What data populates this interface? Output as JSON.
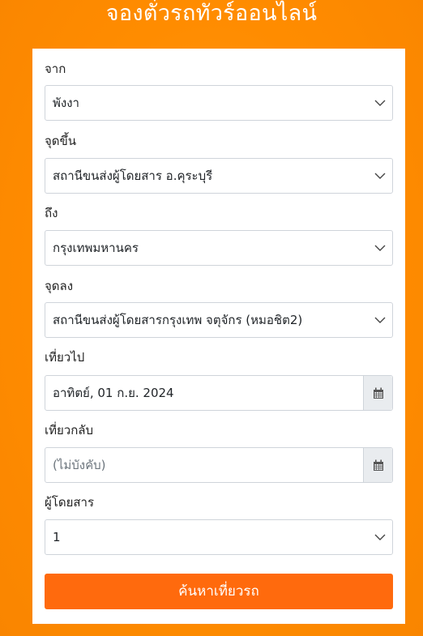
{
  "header": {
    "title": "จองตั๋วรถทัวร์ออนไลน์"
  },
  "form": {
    "from_label": "จาก",
    "from_value": "พังงา",
    "pickup_label": "จุดขึ้น",
    "pickup_value": "สถานีขนส่งผู้โดยสาร อ.คุระบุรี",
    "to_label": "ถึง",
    "to_value": "กรุงเทพมหานคร",
    "dropoff_label": "จุดลง",
    "dropoff_value": "สถานีขนส่งผู้โดยสารกรุงเทพ จตุจักร (หมอชิต2)",
    "depart_label": "เที่ยวไป",
    "depart_value": "อาทิตย์, 01 ก.ย. 2024",
    "return_label": "เที่ยวกลับ",
    "return_placeholder": "(ไม่บังคับ)",
    "passengers_label": "ผู้โดยสาร",
    "passengers_value": "1",
    "search_button": "ค้นหาเที่ยวรถ"
  },
  "colors": {
    "background": "#ff8c00",
    "button": "#ff6a0d"
  },
  "icons": {
    "select": "chevron-down-icon",
    "date": "calendar-icon"
  }
}
